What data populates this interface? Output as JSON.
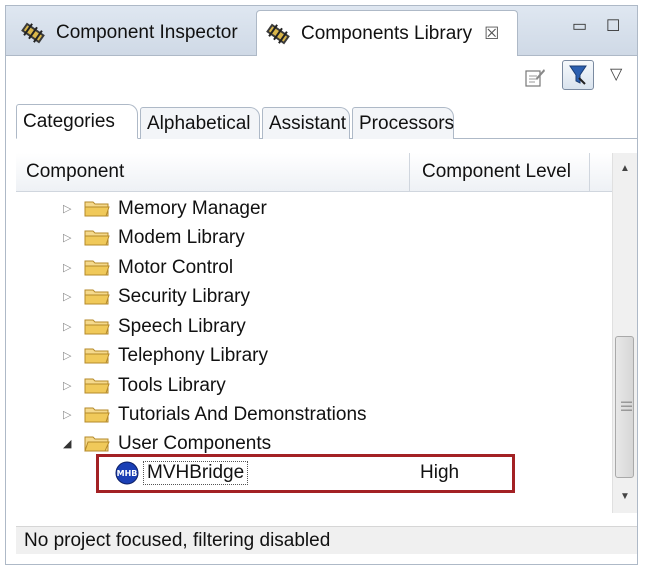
{
  "view_tabs": [
    {
      "label": "Component Inspector",
      "active": false,
      "icon": "component-icon"
    },
    {
      "label": "Components Library",
      "active": true,
      "icon": "component-icon",
      "closable": true
    }
  ],
  "window_controls": {
    "minimize": "▭",
    "maximize": "☐"
  },
  "toolbar": {
    "icons": [
      "edit-properties-icon",
      "filter-icon",
      "view-menu-icon"
    ]
  },
  "sub_tabs": [
    {
      "label": "Categories",
      "active": true
    },
    {
      "label": "Alphabetical",
      "active": false
    },
    {
      "label": "Assistant",
      "active": false
    },
    {
      "label": "Processors",
      "active": false
    }
  ],
  "table": {
    "columns": [
      "Component",
      "Component Level"
    ],
    "rows": [
      {
        "label": "Memory Manager",
        "expanded": false
      },
      {
        "label": "Modem Library",
        "expanded": false
      },
      {
        "label": "Motor Control",
        "expanded": false
      },
      {
        "label": "Security Library",
        "expanded": false
      },
      {
        "label": "Speech Library",
        "expanded": false
      },
      {
        "label": "Telephony Library",
        "expanded": false
      },
      {
        "label": "Tools Library",
        "expanded": false
      },
      {
        "label": "Tutorials And Demonstrations",
        "expanded": false
      },
      {
        "label": "User Components",
        "expanded": true
      }
    ],
    "child": {
      "icon_text": "MHB",
      "label": "MVHBridge",
      "level": "High"
    }
  },
  "status": "No project focused, filtering disabled",
  "colors": {
    "highlight": "#a32124",
    "folder": "#f0c95a",
    "component_badge": "#1a3fb5"
  }
}
